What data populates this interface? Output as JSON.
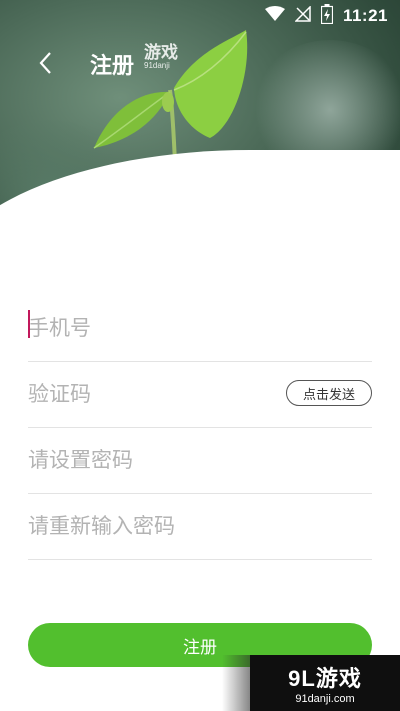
{
  "status_bar": {
    "time": "11:21",
    "icons": [
      "wifi-icon",
      "no-signal-icon",
      "battery-charging-icon"
    ]
  },
  "header": {
    "title": "注册",
    "back_icon": "chevron-left-icon"
  },
  "form": {
    "phone_placeholder": "手机号",
    "code_placeholder": "验证码",
    "send_code_label": "点击发送",
    "password_placeholder": "请设置密码",
    "confirm_password_placeholder": "请重新输入密码"
  },
  "submit_label": "注册",
  "watermark": {
    "top_text": "游戏",
    "top_sub": "91danji",
    "brand": "9L游戏",
    "domain": "91danji.com"
  },
  "colors": {
    "accent_green": "#52bf2e",
    "caret": "#c2185b"
  }
}
